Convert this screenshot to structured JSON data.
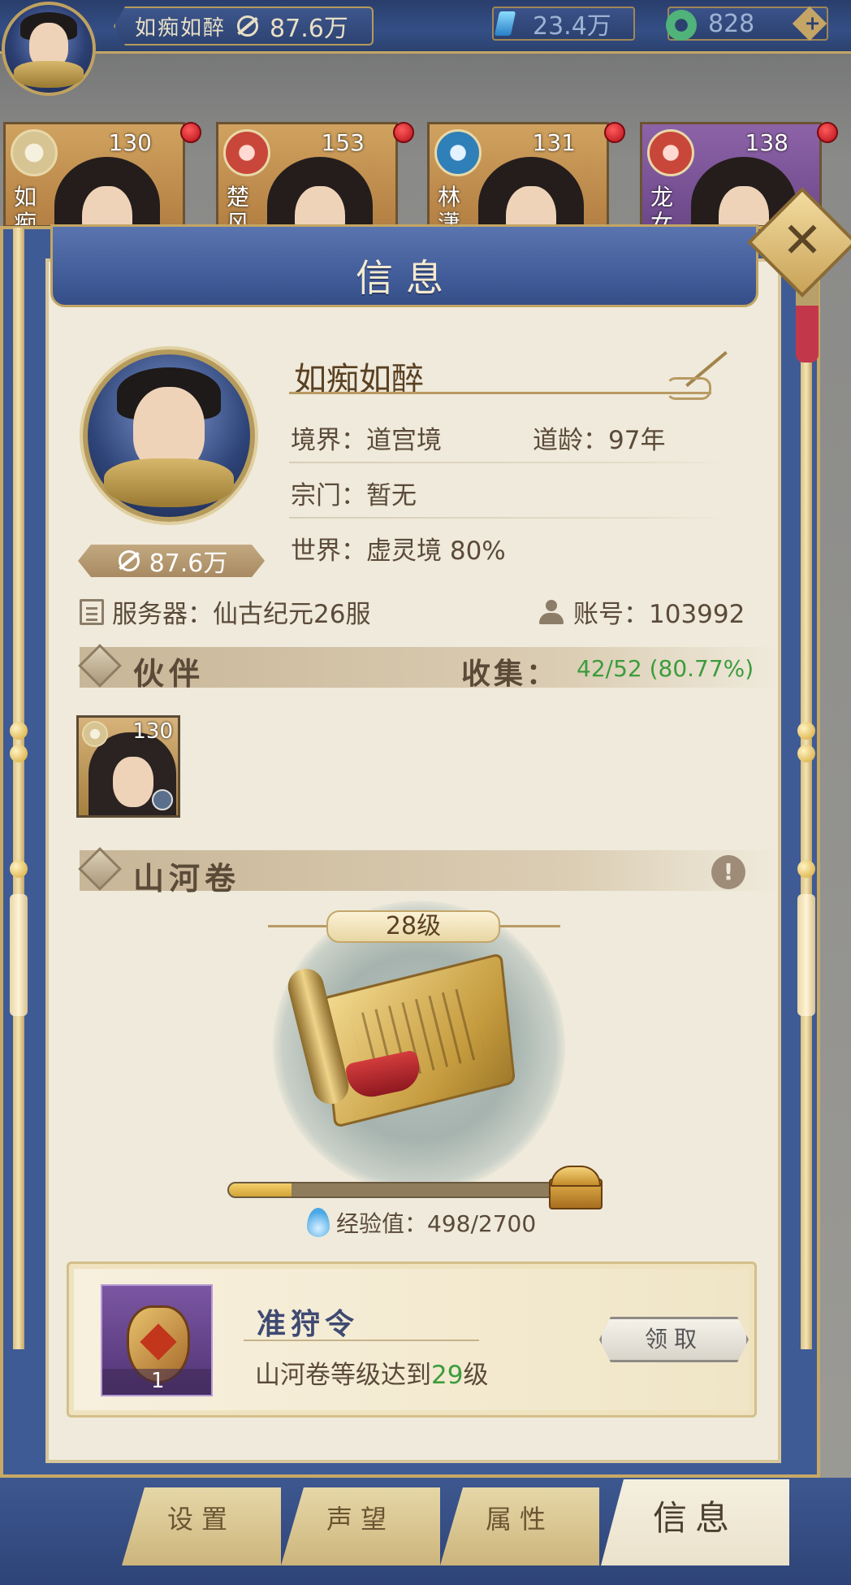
{
  "topbar": {
    "player_name": "如痴如醉",
    "power": "87.6万",
    "currency_crystal": "23.4万",
    "currency_jade": "828"
  },
  "heroes": [
    {
      "level": "130",
      "name": "如痴",
      "element": "sun"
    },
    {
      "level": "153",
      "name": "楚风",
      "element": "fire"
    },
    {
      "level": "131",
      "name": "林潇",
      "element": "water"
    },
    {
      "level": "138",
      "name": "龙女",
      "element": "fire"
    }
  ],
  "panel": {
    "title": "信息",
    "close_label": "✕"
  },
  "profile": {
    "name": "如痴如醉",
    "power": "87.6万",
    "realm": "境界：道宫境",
    "dao_age": "道龄：97年",
    "sect": "宗门：暂无",
    "world": "世界：虚灵境  80%",
    "server": "服务器：仙古纪元26服",
    "account": "账号：103992"
  },
  "companions": {
    "title": "伙伴",
    "collect_label": "收集：",
    "collect_value": "42/52 (80.77%)",
    "items": [
      {
        "level": "130"
      }
    ]
  },
  "shanhe": {
    "title": "山河卷",
    "alert": "!",
    "level": "28级",
    "exp_label": "经验值：498/2700",
    "exp_progress": 0.184
  },
  "reward": {
    "name": "准狩令",
    "count": "1",
    "desc_prefix": "山河卷等级达到",
    "desc_level": "29",
    "desc_suffix": "级",
    "claim_label": "领取"
  },
  "tabs": [
    {
      "label": "设置"
    },
    {
      "label": "声望"
    },
    {
      "label": "属性"
    },
    {
      "label": "信息"
    }
  ],
  "colors": {
    "panel_blue": "#3f5b96",
    "paper": "#efeadb",
    "gold": "#c8a965",
    "highlight_green": "#3c9c3c"
  }
}
